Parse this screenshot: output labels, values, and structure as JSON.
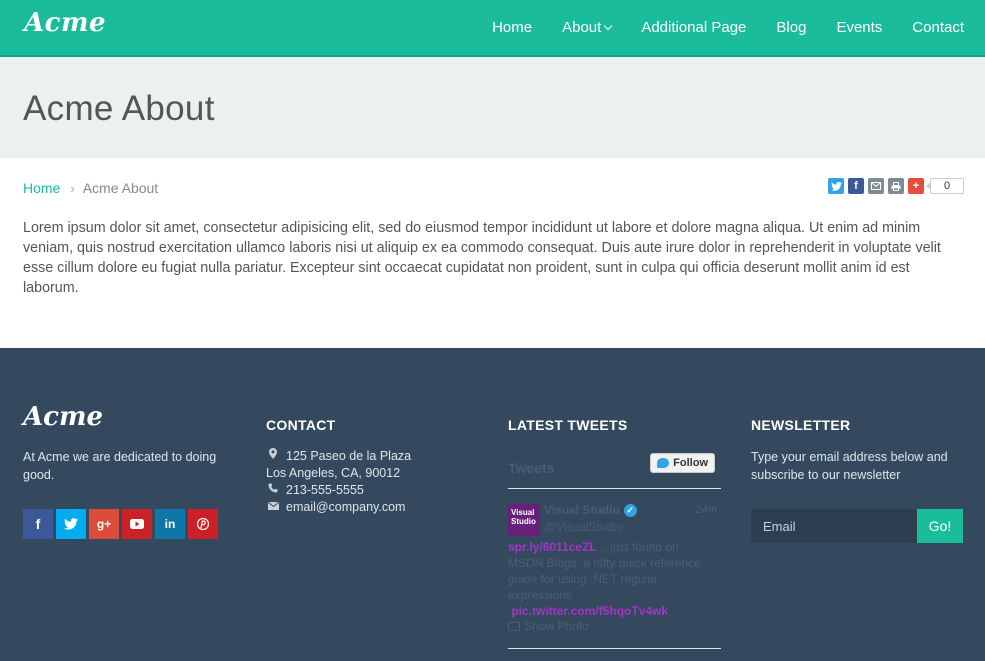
{
  "brand": {
    "logo_text": "Acme"
  },
  "nav": {
    "items": [
      {
        "label": "Home"
      },
      {
        "label": "About",
        "has_dropdown": true
      },
      {
        "label": "Additional Page"
      },
      {
        "label": "Blog"
      },
      {
        "label": "Events"
      },
      {
        "label": "Contact"
      }
    ]
  },
  "page": {
    "title": "Acme About"
  },
  "breadcrumb": {
    "home": "Home",
    "separator": "›",
    "current": "Acme About"
  },
  "share": {
    "count": "0"
  },
  "content": {
    "body": "Lorem ipsum dolor sit amet, consectetur adipisicing elit, sed do eiusmod tempor incididunt ut labore et dolore magna aliqua. Ut enim ad minim veniam, quis nostrud exercitation ullamco laboris nisi ut aliquip ex ea commodo consequat. Duis aute irure dolor in reprehenderit in voluptate velit esse cillum dolore eu fugiat nulla pariatur. Excepteur sint occaecat cupidatat non proident, sunt in culpa qui officia deserunt mollit anim id est laborum."
  },
  "footer": {
    "logo_text": "Acme",
    "about": "At Acme we are dedicated to doing good.",
    "contact": {
      "heading": "CONTACT",
      "address_line1": "125 Paseo de la Plaza",
      "address_line2": "Los Angeles, CA, 90012",
      "phone": "213-555-5555",
      "email": "email@company.com"
    },
    "tweets": {
      "heading": "LATEST TWEETS",
      "widget_title": "Tweets",
      "follow_label": "Follow",
      "tweet": {
        "avatar_text": "Visual Studio",
        "name": "Visual Studio",
        "handle": "@VisualStudio",
        "time": "24m",
        "link1": "spr.ly/6011ceZL",
        "text": " ...just found on MSDN Blogs, a nifty quick reference guide for using .NET regular expressions",
        "link2": "pic.twitter.com/f5hqoTv4wk",
        "show_photo": "Show Photo"
      }
    },
    "newsletter": {
      "heading": "NEWSLETTER",
      "text": "Type your email address below and subscribe to our newsletter",
      "placeholder": "Email",
      "button": "Go!"
    }
  },
  "colors": {
    "accent": "#1abc9c",
    "footer_bg": "#34495e",
    "header_bg": "#ecf0f1"
  }
}
